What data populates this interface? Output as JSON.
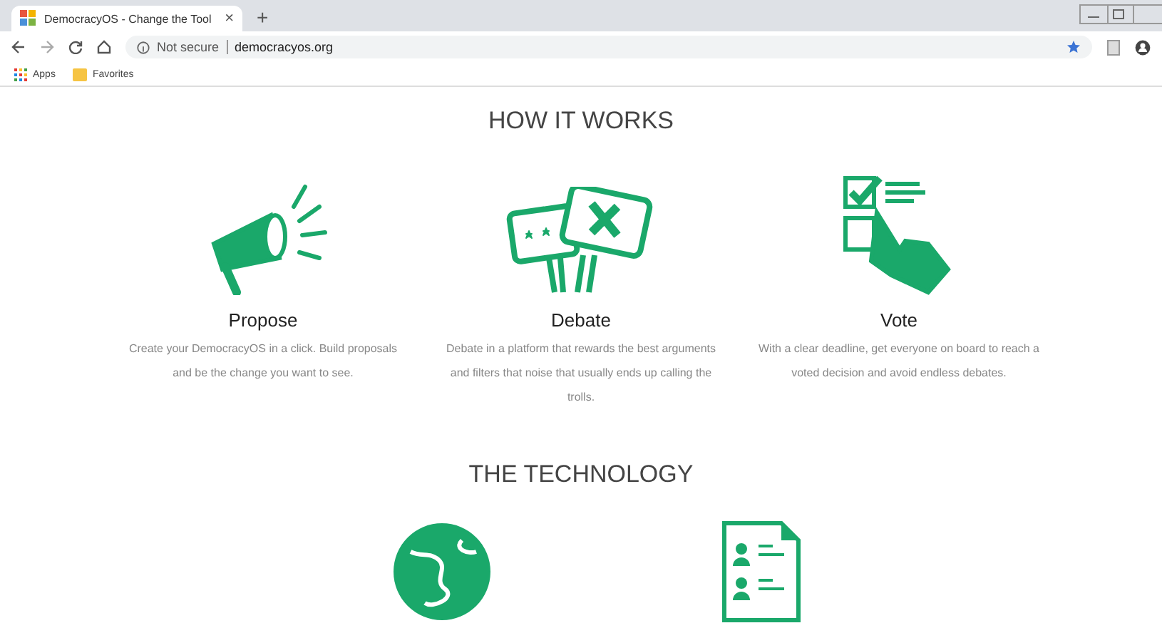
{
  "browser": {
    "tab_title": "DemocracyOS - Change the Tool",
    "tab_close": "×",
    "new_tab": "+",
    "security": "Not secure",
    "url": "democracyos.org",
    "bookmarks": [
      {
        "label": "Apps",
        "kind": "apps"
      },
      {
        "label": "Favorites",
        "kind": "folder"
      }
    ]
  },
  "how_it_works": {
    "heading": "HOW IT WORKS",
    "steps": [
      {
        "kind": "megaphone",
        "title": "Propose",
        "text": "Create your DemocracyOS in a click. Build proposals and be the change you want to see."
      },
      {
        "kind": "signs",
        "title": "Debate",
        "text": "Debate in a platform that rewards the best arguments and filters that noise that usually ends up calling the trolls."
      },
      {
        "kind": "ballot",
        "title": "Vote",
        "text": "With a clear deadline, get everyone on board to reach a voted decision and avoid endless debates."
      }
    ]
  },
  "technology": {
    "heading": "THE TECHNOLOGY",
    "items": [
      {
        "kind": "globe"
      },
      {
        "kind": "document"
      }
    ]
  }
}
